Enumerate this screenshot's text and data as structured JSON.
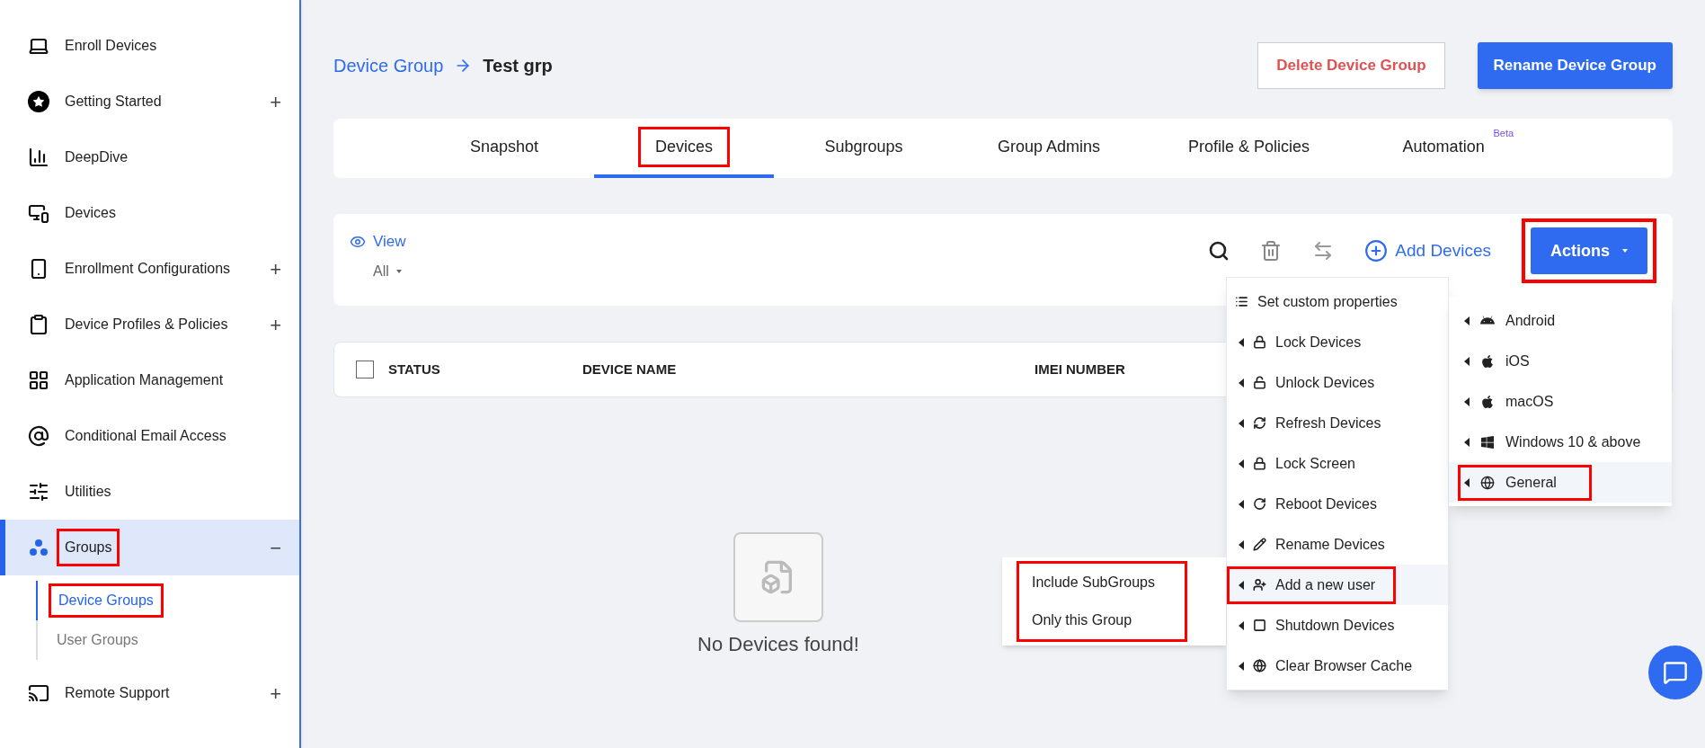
{
  "sidebar": {
    "items": [
      {
        "label": "Enroll Devices",
        "selected": false,
        "highlighted": false
      },
      {
        "label": "Getting Started",
        "toggle": "+",
        "selected": false,
        "highlighted": false
      },
      {
        "label": "DeepDive",
        "selected": false,
        "highlighted": false
      },
      {
        "label": "Devices",
        "selected": false,
        "highlighted": false
      },
      {
        "label": "Enrollment Configurations",
        "toggle": "+",
        "selected": false,
        "highlighted": false
      },
      {
        "label": "Device Profiles & Policies",
        "toggle": "+",
        "selected": false,
        "highlighted": false
      },
      {
        "label": "Application Management",
        "selected": false,
        "highlighted": false
      },
      {
        "label": "Conditional Email Access",
        "selected": false,
        "highlighted": false
      },
      {
        "label": "Utilities",
        "selected": false,
        "highlighted": false
      },
      {
        "label": "Groups",
        "toggle": "−",
        "selected": true,
        "highlighted": true,
        "children": [
          {
            "label": "Device Groups",
            "selected": true,
            "highlighted": true
          },
          {
            "label": "User Groups",
            "selected": false,
            "highlighted": false
          }
        ]
      },
      {
        "label": "Remote Support",
        "toggle": "+",
        "selected": false,
        "highlighted": false
      }
    ]
  },
  "breadcrumb": {
    "parent": "Device Group",
    "current": "Test grp"
  },
  "buttons": {
    "delete": "Delete Device Group",
    "rename": "Rename Device Group"
  },
  "tabs": [
    {
      "label": "Snapshot",
      "selected": false,
      "highlighted": false
    },
    {
      "label": "Devices",
      "selected": true,
      "highlighted": true
    },
    {
      "label": "Subgroups",
      "selected": false,
      "highlighted": false
    },
    {
      "label": "Group Admins",
      "selected": false,
      "highlighted": false
    },
    {
      "label": "Profile & Policies",
      "selected": false,
      "highlighted": false
    },
    {
      "label": "Automation",
      "badge": "Beta",
      "selected": false,
      "highlighted": false
    }
  ],
  "toolbar": {
    "view_label": "View",
    "view_value": "All",
    "add_devices": "Add Devices",
    "actions": "Actions",
    "actions_highlighted": true
  },
  "table": {
    "columns": [
      "STATUS",
      "DEVICE NAME",
      "IMEI NUMBER"
    ],
    "select_all_checked": false
  },
  "empty_state": "No Devices found!",
  "actions_menu": [
    {
      "label": "Set custom properties",
      "submenu": false,
      "highlighted": false,
      "hovered": false
    },
    {
      "label": "Lock Devices",
      "submenu": true,
      "highlighted": false,
      "hovered": false
    },
    {
      "label": "Unlock Devices",
      "submenu": true,
      "highlighted": false,
      "hovered": false
    },
    {
      "label": "Refresh Devices",
      "submenu": true,
      "highlighted": false,
      "hovered": false
    },
    {
      "label": "Lock Screen",
      "submenu": true,
      "highlighted": false,
      "hovered": false
    },
    {
      "label": "Reboot Devices",
      "submenu": true,
      "highlighted": false,
      "hovered": false
    },
    {
      "label": "Rename Devices",
      "submenu": true,
      "highlighted": false,
      "hovered": false
    },
    {
      "label": "Add a new user",
      "submenu": true,
      "highlighted": true,
      "hovered": true
    },
    {
      "label": "Shutdown Devices",
      "submenu": true,
      "highlighted": false,
      "hovered": false
    },
    {
      "label": "Clear Browser Cache",
      "submenu": true,
      "highlighted": false,
      "hovered": false
    }
  ],
  "platform_menu": [
    {
      "label": "Android",
      "highlighted": false,
      "hovered": false
    },
    {
      "label": "iOS",
      "highlighted": false,
      "hovered": false
    },
    {
      "label": "macOS",
      "highlighted": false,
      "hovered": false
    },
    {
      "label": "Windows 10 & above",
      "highlighted": false,
      "hovered": false
    },
    {
      "label": "General",
      "highlighted": true,
      "hovered": true
    }
  ],
  "scope_menu": {
    "highlighted": true,
    "items": [
      "Include SubGroups",
      "Only this Group"
    ]
  }
}
